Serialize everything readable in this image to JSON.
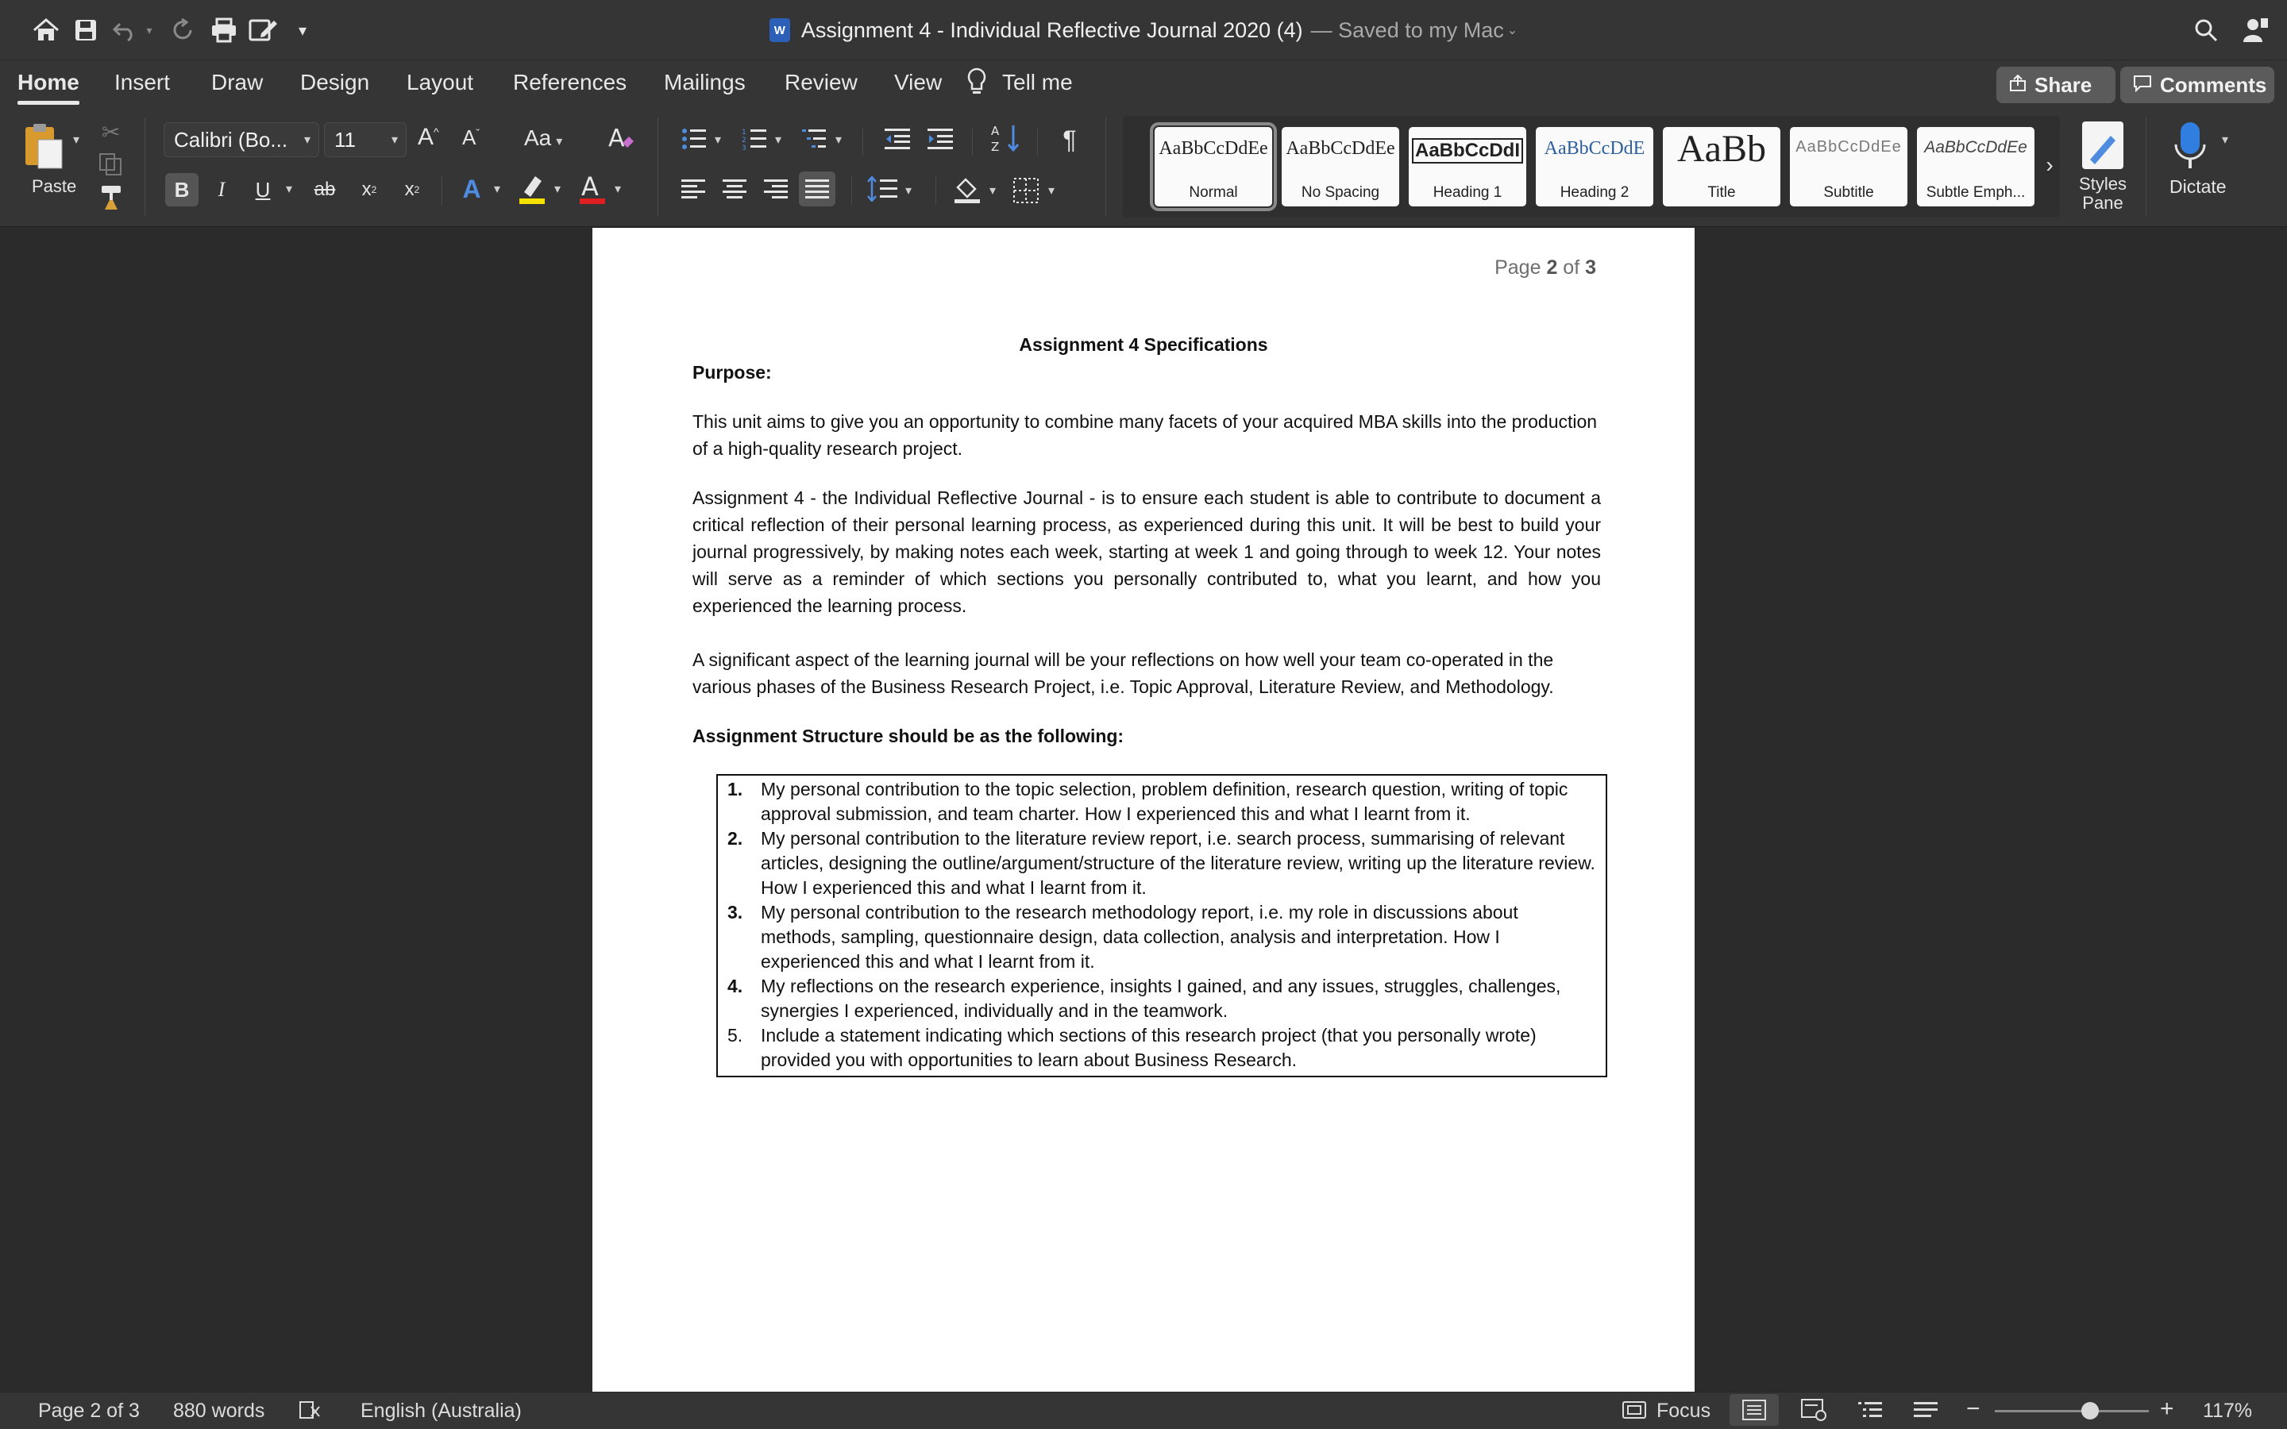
{
  "window": {
    "title": "Assignment 4 - Individual Reflective Journal 2020 (4)",
    "saved_status": "— Saved to my Mac",
    "app_badge": "W"
  },
  "tabs": [
    "Home",
    "Insert",
    "Draw",
    "Design",
    "Layout",
    "References",
    "Mailings",
    "Review",
    "View"
  ],
  "tell_me": "Tell me",
  "share_label": "Share",
  "comments_label": "Comments",
  "ribbon": {
    "paste_label": "Paste",
    "font_name": "Calibri (Bo...",
    "font_size": "11",
    "change_case": "Aa",
    "styles_pane_label": [
      "Styles",
      "Pane"
    ],
    "dictate_label": "Dictate",
    "styles": [
      {
        "sample": "AaBbCcDdEe",
        "name": "Normal"
      },
      {
        "sample": "AaBbCcDdEe",
        "name": "No Spacing"
      },
      {
        "sample": "AaBbCcDdI",
        "name": "Heading 1"
      },
      {
        "sample": "AaBbCcDdE",
        "name": "Heading 2"
      },
      {
        "sample": "AaBb",
        "name": "Title"
      },
      {
        "sample": "AaBbCcDdEe",
        "name": "Subtitle"
      },
      {
        "sample": "AaBbCcDdEe",
        "name": "Subtle Emph..."
      }
    ]
  },
  "document": {
    "page_header": {
      "prefix": "Page ",
      "current": "2",
      "mid": " of ",
      "total": "3"
    },
    "spec_title": "Assignment 4 Specifications",
    "purpose_heading": "Purpose:",
    "para1": "This unit aims to give you an opportunity to combine many facets of your acquired MBA skills into the production of a high-quality research project.",
    "para2": "Assignment 4 - the Individual Reflective Journal - is to ensure each student is able to contribute to document a critical reflection of their personal learning process, as experienced during this unit. It will be best to build your journal progressively, by making notes each week, starting at week 1 and going through to week 12. Your notes will serve as a reminder of which sections you personally contributed to, what you learnt, and how you experienced the learning process.",
    "para3": "A significant aspect of the learning journal will be your reflections on how well your team co-operated in the various phases of the Business Research Project, i.e. Topic Approval, Literature Review, and Methodology.",
    "structure_heading": "Assignment Structure should be as the following:",
    "structure_items": [
      {
        "num": "1.",
        "text": "My personal contribution to the topic selection, problem definition, research question, writing of topic approval submission, and team charter. How I experienced this and what I learnt from it."
      },
      {
        "num": "2.",
        "text": "My personal contribution to the literature review report, i.e. search process, summarising of relevant articles, designing the outline/argument/structure of the literature review, writing up the literature review. How I experienced this and what I learnt from it."
      },
      {
        "num": "3.",
        "text": "My personal contribution to the research methodology report, i.e. my role in discussions about methods, sampling, questionnaire design, data collection, analysis and interpretation. How I experienced this and what I learnt from it."
      },
      {
        "num": "4.",
        "text": "My reflections on the research experience, insights I gained, and any issues, struggles, challenges, synergies I experienced, individually and in the teamwork."
      },
      {
        "num": "5.",
        "text": "Include a statement indicating which sections of this research project (that you personally wrote) provided you with opportunities to learn about Business Research."
      }
    ]
  },
  "status": {
    "page": "Page 2 of 3",
    "words": "880 words",
    "language": "English (Australia)",
    "focus": "Focus",
    "zoom": "117%",
    "zoom_level": 0.62
  }
}
